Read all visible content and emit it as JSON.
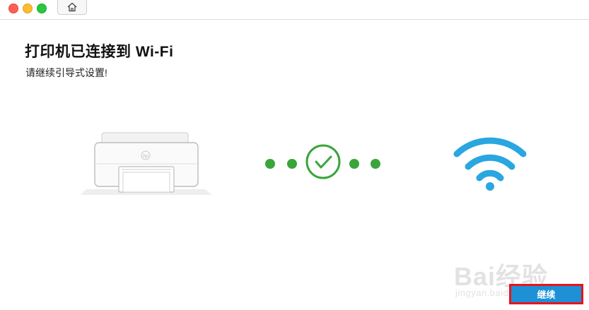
{
  "window": {
    "traffic_lights": [
      {
        "name": "close",
        "color": "#ff5f57"
      },
      {
        "name": "minimize",
        "color": "#febc2e"
      },
      {
        "name": "maximize",
        "color": "#28c840"
      }
    ],
    "home_icon": "home-icon"
  },
  "main": {
    "title": "打印机已连接到 Wi-Fi",
    "subtitle": "请继续引导式设置!"
  },
  "illustration": {
    "printer_icon": "printer-icon",
    "status_icon": "check-circle-icon",
    "wifi_icon": "wifi-icon",
    "success_color": "#3aa53a",
    "wifi_color": "#2aa6e0"
  },
  "footer": {
    "continue_label": "继续"
  },
  "watermark": {
    "text": "Bai经验",
    "url": "jingyan.baidu.com"
  }
}
